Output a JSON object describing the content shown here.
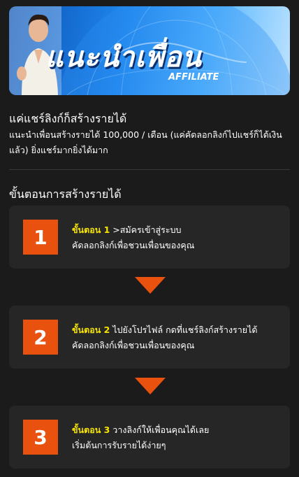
{
  "banner": {
    "title": "แนะนำเพื่อน",
    "subtitle": "AFFILIATE"
  },
  "intro": {
    "title": "แค่แชร์ลิงก์ก็สร้างรายได้",
    "body": "แนะนำเพื่อนสร้างรายได้ 100,000 / เดือน (แค่คัดลอกลิงก์ไปแชร์ก็ได้เงินแล้ว) ยิ่งแชร์มากยิ่งได้มาก"
  },
  "section": {
    "title": "ขั้นตอนการสร้างรายได้"
  },
  "steps": [
    {
      "number": "1",
      "label": "ขั้นตอน 1",
      "text": ">สมัครเข้าสู่ระบบ",
      "detail": "คัดลอกลิงก์เพื่อชวนเพื่อนของคุณ"
    },
    {
      "number": "2",
      "label": "ขั้นตอน 2",
      "text": "ไปยังโปรไฟล์ กดที่แชร์ลิงก์สร้างรายได้",
      "detail": "คัดลอกลิงก์เพื่อชวนเพื่อนของคุณ"
    },
    {
      "number": "3",
      "label": "ขั้นตอน 3",
      "text": "วางลิงก์ให้เพื่อนคุณได้เลย",
      "detail": "เริ่มต้นการรับรายได้ง่ายๆ"
    }
  ],
  "colors": {
    "accent": "#e8520e",
    "highlight": "#f6e400",
    "card": "#262626",
    "background": "#1b1b1b"
  },
  "icons": {
    "arrow": "chevron-down-icon"
  }
}
